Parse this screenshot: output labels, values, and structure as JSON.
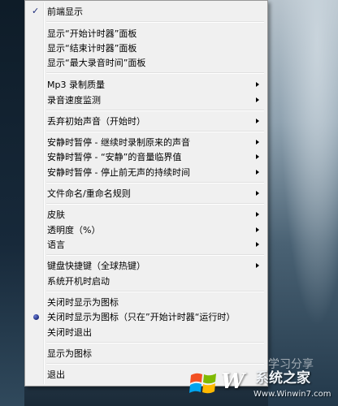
{
  "menu": {
    "items": [
      {
        "label": "前端显示",
        "checked": true,
        "submenu": false
      },
      {
        "label": "显示“开始计时器”面板",
        "submenu": false
      },
      {
        "label": "显示“结束计时器”面板",
        "submenu": false
      },
      {
        "label": "显示“最大录音时间”面板",
        "submenu": false
      },
      {
        "label": "Mp3 录制质量",
        "submenu": true
      },
      {
        "label": "录音速度监测",
        "submenu": true
      },
      {
        "label": "丢弃初始声音（开始时）",
        "submenu": true
      },
      {
        "label": "安静时暂停 - 继续时录制原来的声音",
        "submenu": true
      },
      {
        "label": "安静时暂停 - “安静”的音量临界值",
        "submenu": true
      },
      {
        "label": "安静时暂停 - 停止前无声的持续时间",
        "submenu": true
      },
      {
        "label": "文件命名/重命名规则",
        "submenu": true
      },
      {
        "label": "皮肤",
        "submenu": true
      },
      {
        "label": "透明度（%）",
        "submenu": true
      },
      {
        "label": "语言",
        "submenu": true
      },
      {
        "label": "键盘快捷键（全球热键）",
        "submenu": true
      },
      {
        "label": "系统开机时启动",
        "submenu": false
      },
      {
        "label": "关闭时显示为图标",
        "submenu": false
      },
      {
        "label": "关闭时显示为图标（只在”开始计时器“运行时）",
        "radio": true,
        "submenu": false
      },
      {
        "label": "关闭时退出",
        "submenu": false
      },
      {
        "label": "显示为图标",
        "submenu": false
      },
      {
        "label": "退出",
        "submenu": false
      }
    ]
  },
  "watermark": {
    "brand_letter": "W",
    "site_name": "系统之家",
    "url": "Www.Winwin7.com",
    "faint_text": "学习分享"
  },
  "colors": {
    "menu_bg": "#f0f0f0",
    "menu_border": "#979797",
    "check": "#1b2a7a"
  }
}
